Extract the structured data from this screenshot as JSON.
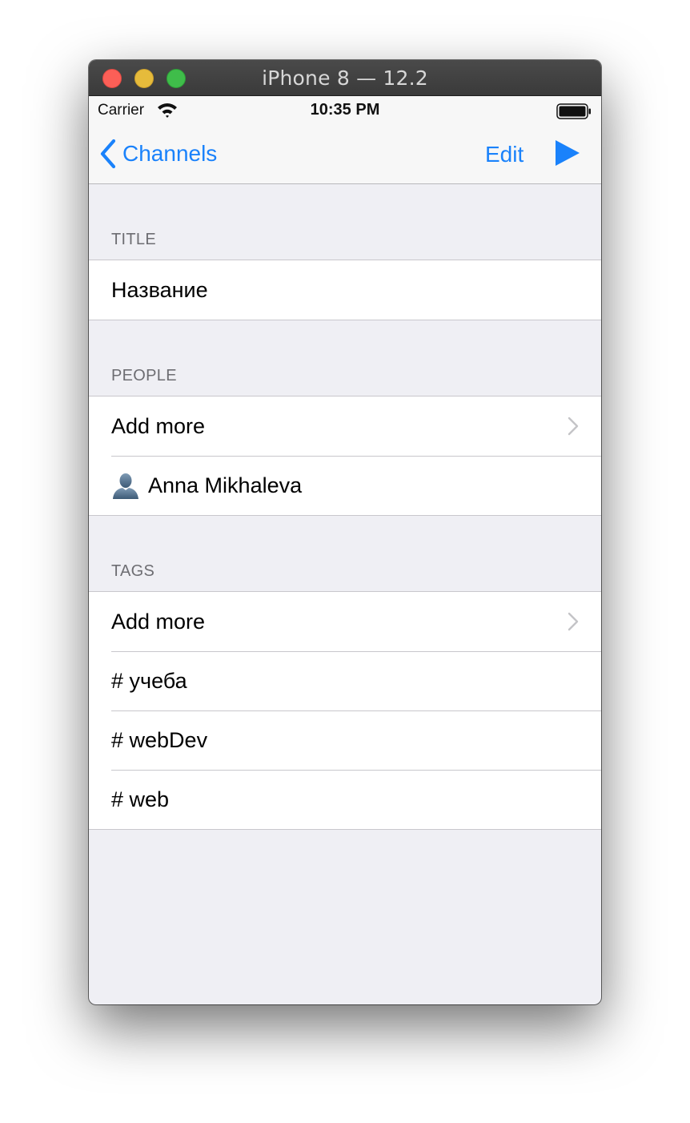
{
  "window": {
    "title": "iPhone 8 — 12.2"
  },
  "status_bar": {
    "carrier": "Carrier",
    "time": "10:35 PM"
  },
  "nav": {
    "back_label": "Channels",
    "edit_label": "Edit"
  },
  "sections": {
    "title": {
      "header": "TITLE",
      "value": "Название"
    },
    "people": {
      "header": "PEOPLE",
      "add_more": "Add more",
      "items": [
        "Anna Mikhaleva"
      ]
    },
    "tags": {
      "header": "TAGS",
      "add_more": "Add more",
      "items": [
        "# учеба",
        "# webDev",
        "# web"
      ]
    }
  },
  "colors": {
    "accent": "#1a82fb",
    "background": "#efeff4"
  }
}
